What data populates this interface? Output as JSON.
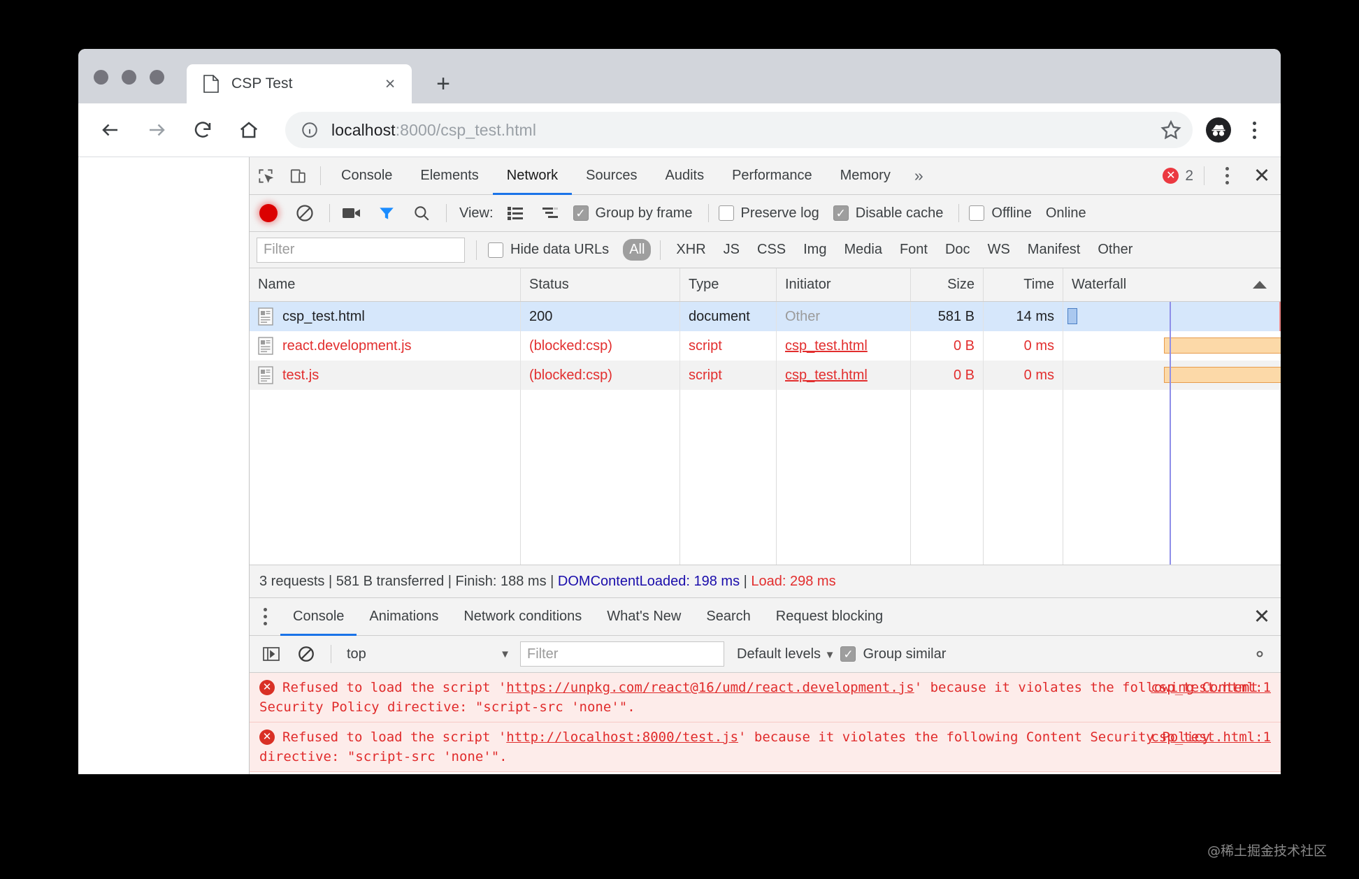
{
  "browser": {
    "tab": {
      "title": "CSP Test",
      "favicon": "page-icon",
      "close": "×"
    },
    "new_tab": "+",
    "nav": {
      "back": "←",
      "forward": "→",
      "reload": "⟳",
      "home": "⌂"
    },
    "omnibox": {
      "info_icon": "info-icon",
      "url_host": "localhost",
      "url_path": ":8000/csp_test.html",
      "star_icon": "star-icon"
    },
    "profile_icon": "incognito-avatar-icon",
    "menu_icon": "kebab-menu-icon"
  },
  "devtools": {
    "inspect_icon": "inspect-element-icon",
    "device_icon": "device-toolbar-icon",
    "tabs": [
      {
        "label": "Console",
        "active": false
      },
      {
        "label": "Elements",
        "active": false
      },
      {
        "label": "Network",
        "active": true
      },
      {
        "label": "Sources",
        "active": false
      },
      {
        "label": "Audits",
        "active": false
      },
      {
        "label": "Performance",
        "active": false
      },
      {
        "label": "Memory",
        "active": false
      }
    ],
    "more_tabs": "»",
    "error_count": "2",
    "error_glyph": "✕",
    "close": "✕",
    "accent_color": "#1a73e8",
    "error_color": "#eb3941"
  },
  "network_toolbar": {
    "record_label": "record-button",
    "clear_label": "clear-button",
    "camera_label": "capture-screenshots-icon",
    "filter_label": "filter-icon",
    "search_label": "search-icon",
    "view_label": "View:",
    "view_list_icon": "list-view-icon",
    "view_waterfall_icon": "waterfall-view-icon",
    "group_by_frame": {
      "label": "Group by frame",
      "checked": true
    },
    "preserve_log": {
      "label": "Preserve log",
      "checked": false
    },
    "disable_cache": {
      "label": "Disable cache",
      "checked": true
    },
    "offline": {
      "label": "Offline",
      "checked": false
    },
    "online_label": "Online"
  },
  "filter_bar": {
    "filter_placeholder": "Filter",
    "filter_value": "",
    "hide_data_urls": {
      "label": "Hide data URLs",
      "checked": false
    },
    "types": [
      {
        "label": "All",
        "active": true
      },
      {
        "label": "XHR",
        "active": false
      },
      {
        "label": "JS",
        "active": false
      },
      {
        "label": "CSS",
        "active": false
      },
      {
        "label": "Img",
        "active": false
      },
      {
        "label": "Media",
        "active": false
      },
      {
        "label": "Font",
        "active": false
      },
      {
        "label": "Doc",
        "active": false
      },
      {
        "label": "WS",
        "active": false
      },
      {
        "label": "Manifest",
        "active": false
      },
      {
        "label": "Other",
        "active": false
      }
    ]
  },
  "table": {
    "headers": {
      "name": "Name",
      "status": "Status",
      "type": "Type",
      "initiator": "Initiator",
      "size": "Size",
      "time": "Time",
      "waterfall": "Waterfall"
    },
    "rows": [
      {
        "name": "csp_test.html",
        "status": "200",
        "type": "document",
        "initiator": "Other",
        "size": "581 B",
        "time": "14 ms",
        "selected": true,
        "error": false
      },
      {
        "name": "react.development.js",
        "status": "(blocked:csp)",
        "type": "script",
        "initiator": "csp_test.html",
        "size": "0 B",
        "time": "0 ms",
        "selected": false,
        "error": true
      },
      {
        "name": "test.js",
        "status": "(blocked:csp)",
        "type": "script",
        "initiator": "csp_test.html",
        "size": "0 B",
        "time": "0 ms",
        "selected": false,
        "error": true
      }
    ]
  },
  "summary": {
    "requests": "3 requests",
    "sep1": " | ",
    "transferred": "581 B transferred",
    "sep2": " | ",
    "finish": "Finish: 188 ms",
    "sep3": " | ",
    "dcl": "DOMContentLoaded: 198 ms",
    "sep4": " | ",
    "load": "Load: 298 ms",
    "dcl_color": "#1a0dab",
    "load_color": "#e22e2e"
  },
  "drawer": {
    "tabs": [
      {
        "label": "Console",
        "active": true
      },
      {
        "label": "Animations",
        "active": false
      },
      {
        "label": "Network conditions",
        "active": false
      },
      {
        "label": "What's New",
        "active": false
      },
      {
        "label": "Search",
        "active": false
      },
      {
        "label": "Request blocking",
        "active": false
      }
    ],
    "close": "✕",
    "console_toolbar": {
      "sidebar_icon": "console-sidebar-icon",
      "clear_icon": "clear-console-icon",
      "context": "top",
      "context_caret": "▼",
      "filter_placeholder": "Filter",
      "filter_value": "",
      "levels": "Default levels",
      "levels_caret": "▼",
      "group_similar": {
        "label": "Group similar",
        "checked": true
      },
      "settings_icon": "gear-icon"
    },
    "messages": [
      {
        "icon": "error-icon",
        "pre": "Refused to load the script '",
        "link": "https://unpkg.com/react@16/umd/react.development.js",
        "post": "' because it violates the following Content Security Policy directive: \"script-src 'none'\".",
        "source": "csp_test.html:1"
      },
      {
        "icon": "error-icon",
        "pre": "Refused to load the script '",
        "link": "http://localhost:8000/test.js",
        "post": "' because it violates the following Content Security Policy directive: \"script-src 'none'\".",
        "source": "csp_test.html:1"
      }
    ],
    "prompt": "❯"
  },
  "watermark": "@稀土掘金技术社区"
}
